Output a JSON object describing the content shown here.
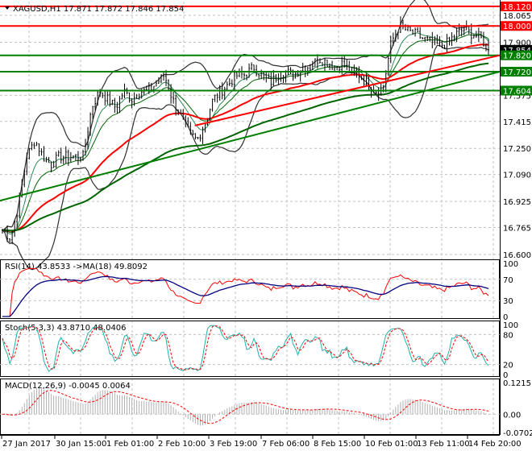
{
  "chart_data": {
    "type": "line",
    "symbol": "XAGUSD,H1",
    "ohlc_header": "17.871 17.872 17.846 17.854",
    "price_ticks": [
      "18.065",
      "17.900",
      "17.575",
      "17.415",
      "17.250",
      "17.090",
      "16.925",
      "16.765",
      "16.600"
    ],
    "price_tick_values": [
      18.065,
      17.9,
      17.575,
      17.415,
      17.25,
      17.09,
      16.925,
      16.765,
      16.6
    ],
    "ylim": [
      16.6,
      18.13
    ],
    "closes": [
      16.75,
      16.7,
      16.9,
      17.2,
      17.3,
      17.2,
      17.15,
      17.2,
      17.2,
      17.2,
      17.2,
      17.5,
      17.6,
      17.55,
      17.5,
      17.6,
      17.55,
      17.6,
      17.6,
      17.65,
      17.7,
      17.55,
      17.45,
      17.35,
      17.3,
      17.4,
      17.55,
      17.6,
      17.65,
      17.7,
      17.7,
      17.75,
      17.7,
      17.65,
      17.7,
      17.72,
      17.7,
      17.75,
      17.75,
      17.8,
      17.78,
      17.75,
      17.77,
      17.72,
      17.7,
      17.65,
      17.6,
      17.62,
      17.9,
      18.0,
      17.97,
      17.95,
      17.92,
      17.9,
      17.88,
      17.9,
      17.95,
      17.98,
      17.95,
      17.93,
      17.854
    ],
    "levels": [
      {
        "label": "18.120",
        "value": 18.12,
        "color": "#ff0000"
      },
      {
        "label": "18.000",
        "value": 18.0,
        "color": "#ff0000"
      },
      {
        "label": "17.820",
        "value": 17.82,
        "color": "#007f00"
      },
      {
        "label": "17.720",
        "value": 17.72,
        "color": "#007f00"
      },
      {
        "label": "17.604",
        "value": 17.604,
        "color": "#007f00"
      }
    ],
    "current_price": {
      "label": "17.854",
      "value": 17.854
    },
    "trendlines": [
      {
        "color": "#ff0000",
        "start_fraction": 0.39,
        "start": 17.39,
        "end": 17.82
      },
      {
        "color": "#007f00",
        "start_fraction": 0.0,
        "start": 16.93,
        "end": 17.72
      }
    ],
    "x_labels": [
      "27 Jan 2017",
      "30 Jan 15:00",
      "1 Feb 01:00",
      "2 Feb 10:00",
      "3 Feb 19:00",
      "7 Feb 06:00",
      "8 Feb 15:00",
      "10 Feb 01:00",
      "13 Feb 11:00",
      "14 Feb 20:00"
    ],
    "rsi": {
      "label": "RSI(14) 43.8533  ->MA(18) 49.8092",
      "ticks": [
        "100",
        "70",
        "30",
        "0"
      ],
      "tick_values": [
        100,
        70,
        30,
        0
      ]
    },
    "stoch": {
      "label": "Stoch(5,3,3) 43.8710 48.0406",
      "ticks": [
        "100",
        "80",
        "20",
        "0"
      ],
      "tick_values": [
        100,
        80,
        20,
        0
      ]
    },
    "macd": {
      "label": "MACD(12,26,9) -0.0045 0.0064",
      "ticks": [
        "0.1215",
        "0.00",
        "-0.0702"
      ],
      "tick_values": [
        0.1215,
        0,
        -0.0702
      ]
    }
  }
}
